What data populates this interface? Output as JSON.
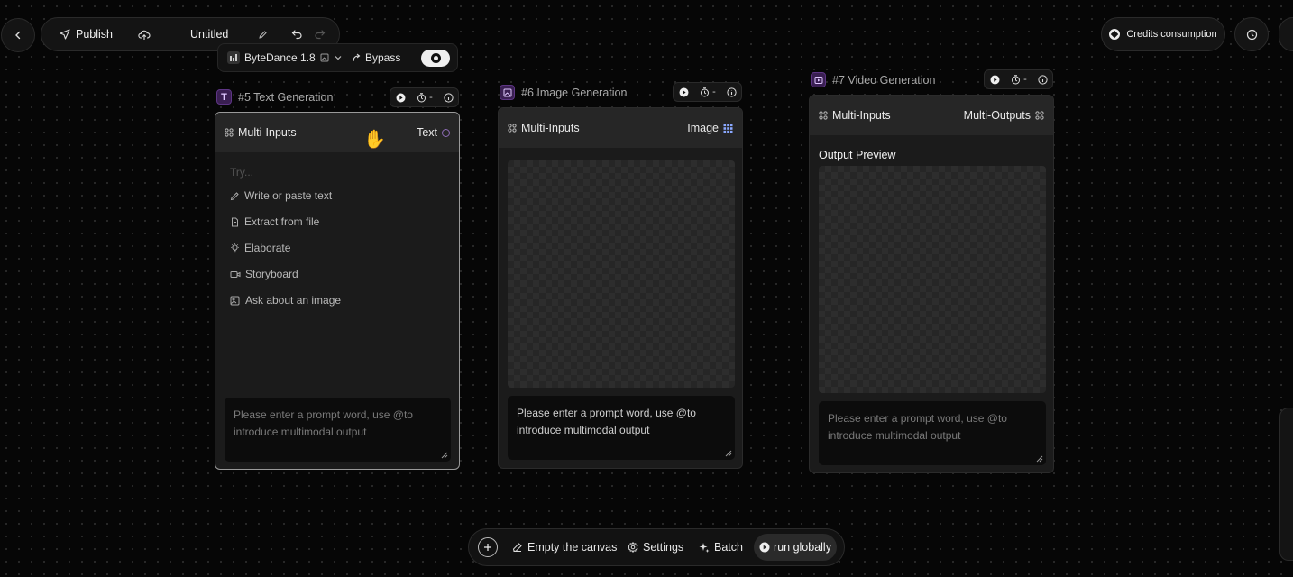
{
  "toolbar": {
    "publish_label": "Publish",
    "title": "Untitled"
  },
  "model_bar": {
    "model_label": "ByteDance 1.8",
    "bypass_label": "Bypass"
  },
  "top_right": {
    "credits_label": "Credits consumption"
  },
  "nodes": {
    "text": {
      "badge": "T",
      "title": "#5 Text Generation",
      "inputs_label": "Multi-Inputs",
      "output_label": "Text",
      "timer_value": "-",
      "try_label": "Try...",
      "try_items": [
        "Write or paste text",
        "Extract from file",
        "Elaborate",
        "Storyboard",
        "Ask about an image"
      ],
      "prompt_placeholder": "Please enter a prompt word, use @to introduce multimodal output"
    },
    "image": {
      "title": "#6 Image Generation",
      "inputs_label": "Multi-Inputs",
      "output_label": "Image",
      "timer_value": "-",
      "prompt_text": "Please enter a prompt word, use @to introduce multimodal output"
    },
    "video": {
      "title": "#7 Video Generation",
      "inputs_label": "Multi-Inputs",
      "output_label": "Multi-Outputs",
      "timer_value": "-",
      "preview_label": "Output Preview",
      "prompt_placeholder": "Please enter a prompt word, use @to introduce multimodal output"
    }
  },
  "bottom_bar": {
    "empty_label": "Empty the canvas",
    "settings_label": "Settings",
    "batch_label": "Batch",
    "run_label": "run globally"
  },
  "colors": {
    "background": "#060606",
    "accent_purple": "#7a3fb0",
    "card": "#1b1b1b",
    "card_header": "#262626"
  }
}
